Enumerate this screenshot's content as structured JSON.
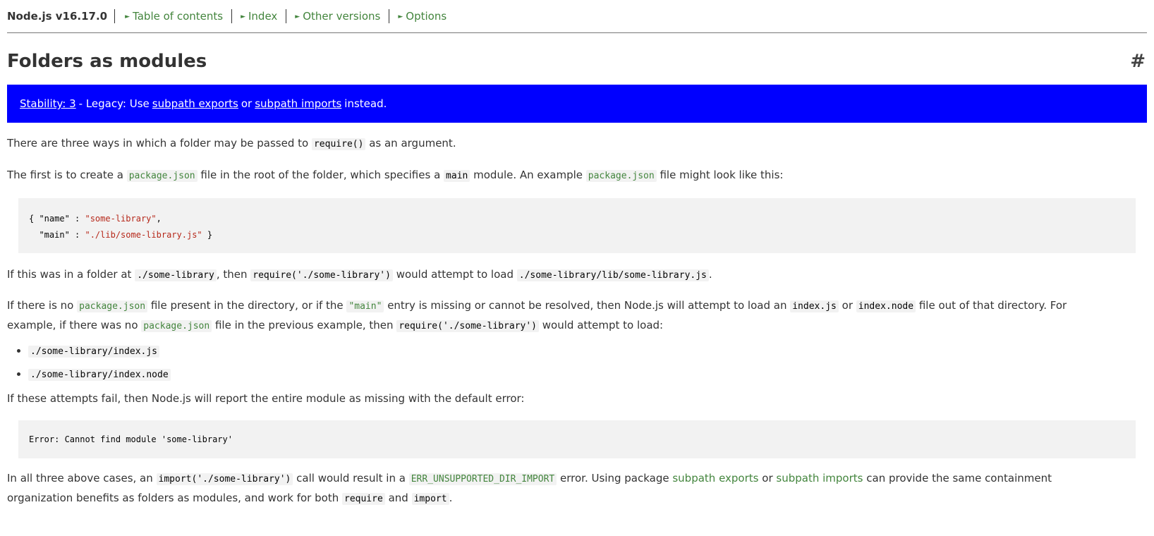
{
  "nav": {
    "brand": "Node.js v16.17.0",
    "items": [
      {
        "label": "Table of contents"
      },
      {
        "label": "Index"
      },
      {
        "label": "Other versions"
      },
      {
        "label": "Options"
      }
    ],
    "arrow": "►"
  },
  "heading": {
    "title": "Folders as modules",
    "hash": "#"
  },
  "stability": {
    "badge": "Stability: 3",
    "text_before": "- Legacy: Use",
    "link1": "subpath exports",
    "or": "or",
    "link2": "subpath imports",
    "text_after": "instead."
  },
  "p1": {
    "t1": "There are three ways in which a folder may be passed to",
    "code": "require()",
    "t2": "as an argument."
  },
  "p2": {
    "t1": "The first is to create a",
    "link1": "package.json",
    "t2": "file in the root of the folder, which specifies a",
    "code": "main",
    "t3": "module. An example",
    "link2": "package.json",
    "t4": "file might look like this:"
  },
  "code1": {
    "l1_a": "{ \"name\" : ",
    "l1_b": "\"some-library\"",
    "l1_c": ",",
    "l2_a": "  \"main\" : ",
    "l2_b": "\"./lib/some-library.js\"",
    "l2_c": " }"
  },
  "p3": {
    "t1": "If this was in a folder at",
    "c1": "./some-library",
    "t2": ", then",
    "c2": "require('./some-library')",
    "t3": "would attempt to load",
    "c3": "./some-library/lib/some-library.js",
    "t4": "."
  },
  "p4": {
    "t1": "If there is no",
    "link1": "package.json",
    "t2": "file present in the directory, or if the",
    "link2": "\"main\"",
    "t3": "entry is missing or cannot be resolved, then Node.js will attempt to load an",
    "c1": "index.js",
    "t4": "or",
    "c2": "index.node",
    "t5": "file out of that directory. For example, if there was no",
    "link3": "package.json",
    "t6": "file in the previous example, then",
    "c3": "require('./some-library')",
    "t7": "would attempt to load:"
  },
  "list": [
    "./some-library/index.js",
    "./some-library/index.node"
  ],
  "p5": {
    "t1": "If these attempts fail, then Node.js will report the entire module as missing with the default error:"
  },
  "code2": {
    "line": "Error: Cannot find module 'some-library'"
  },
  "p6": {
    "t1": "In all three above cases, an",
    "c1": "import('./some-library')",
    "t2": "call would result in a",
    "link1": "ERR_UNSUPPORTED_DIR_IMPORT",
    "t3": "error. Using package",
    "link2": "subpath exports",
    "t4": "or",
    "link3": "subpath imports",
    "t5": "can provide the same containment organization benefits as folders as modules, and work for both",
    "c2": "require",
    "t6": "and",
    "c3": "import",
    "t7": "."
  },
  "colors": {
    "link": "#43853d",
    "stability_bg": "#0000ff",
    "code_bg": "#f2f2f2",
    "string": "#b6281a"
  }
}
